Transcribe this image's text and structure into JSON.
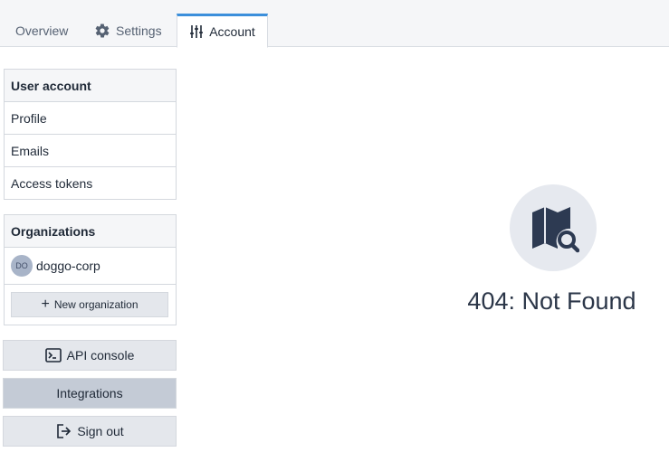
{
  "tabs": [
    {
      "label": "Overview",
      "icon": "none"
    },
    {
      "label": "Settings",
      "icon": "gear-icon"
    },
    {
      "label": "Account",
      "icon": "sliders-icon",
      "active": true
    }
  ],
  "user_account": {
    "heading": "User account",
    "items": [
      "Profile",
      "Emails",
      "Access tokens"
    ]
  },
  "organizations": {
    "heading": "Organizations",
    "orgs": [
      {
        "initials": "DO",
        "name": "doggo-corp"
      }
    ],
    "new_button": "New organization"
  },
  "buttons": {
    "api_console": "API console",
    "integrations": "Integrations",
    "sign_out": "Sign out"
  },
  "not_found": {
    "message": "404: Not Found",
    "icon": "map-search-icon"
  },
  "colors": {
    "accent": "#3b8fdb",
    "icon_dark": "#2d3a52",
    "active_button": "#c4cbd6"
  }
}
